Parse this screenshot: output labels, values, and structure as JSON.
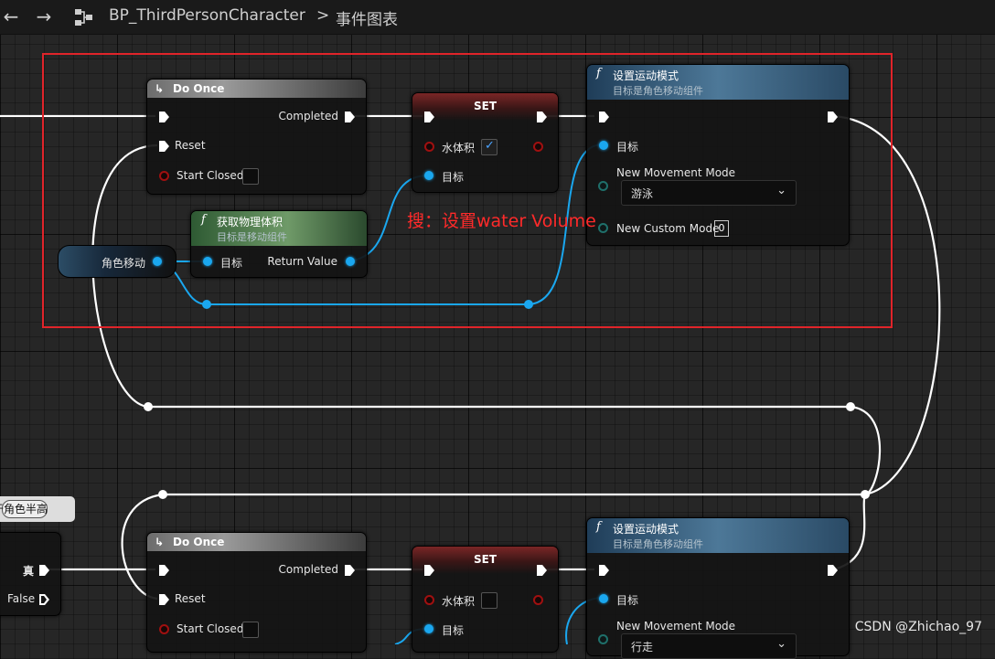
{
  "toolbar": {
    "breadcrumb": {
      "blueprint": "BP_ThirdPersonCharacter",
      "separator": ">",
      "graph": "事件图表"
    }
  },
  "annotation": "搜：设置water Volume",
  "watermark": "CSDN @Zhichao_97",
  "colors": {
    "exec_wire": "#ffffff",
    "object_wire": "#1aa7ef",
    "highlight_box": "#e0242a",
    "annotation": "#ff2a2a"
  },
  "top_section": {
    "do_once": {
      "title": "Do Once",
      "completed": "Completed",
      "reset": "Reset",
      "start_closed": "Start Closed"
    },
    "set_node": {
      "title": "SET",
      "water_volume": "水体积",
      "water_volume_checked": true,
      "target": "目标"
    },
    "get_physics": {
      "title": "获取物理体积",
      "subtitle": "目标是移动组件",
      "target": "目标",
      "return_value": "Return Value"
    },
    "char_move_var": "角色移动",
    "set_mode": {
      "title": "设置运动模式",
      "subtitle": "目标是角色移动组件",
      "target": "目标",
      "new_movement_mode": "New Movement Mode",
      "mode_value": "游泳",
      "new_custom_mode": "New Custom Mode",
      "custom_mode_value": "0"
    }
  },
  "bottom_section": {
    "branch": {
      "true": "真",
      "false": "False"
    },
    "partial_pill": "于角色半高",
    "do_once": {
      "title": "Do Once",
      "completed": "Completed",
      "reset": "Reset",
      "start_closed": "Start Closed"
    },
    "set_node": {
      "title": "SET",
      "water_volume": "水体积",
      "water_volume_checked": false,
      "target": "目标"
    },
    "set_mode": {
      "title": "设置运动模式",
      "subtitle": "目标是角色移动组件",
      "target": "目标",
      "new_movement_mode": "New Movement Mode",
      "mode_value": "行走"
    }
  }
}
